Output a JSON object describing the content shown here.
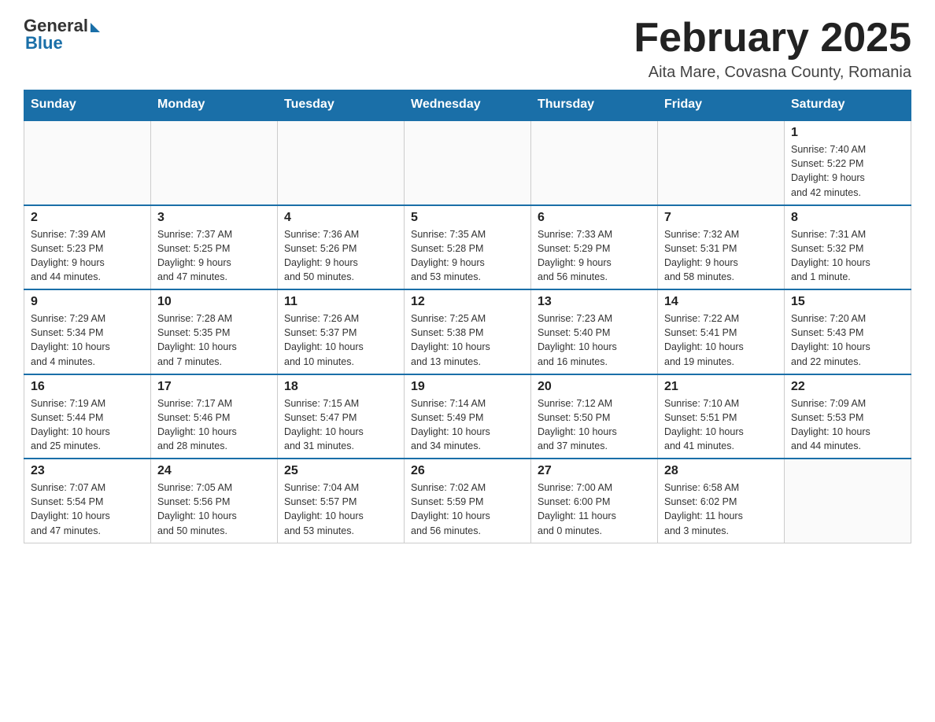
{
  "header": {
    "logo_general": "General",
    "logo_blue": "Blue",
    "month_title": "February 2025",
    "location": "Aita Mare, Covasna County, Romania"
  },
  "weekdays": [
    "Sunday",
    "Monday",
    "Tuesday",
    "Wednesday",
    "Thursday",
    "Friday",
    "Saturday"
  ],
  "weeks": [
    [
      {
        "day": "",
        "info": ""
      },
      {
        "day": "",
        "info": ""
      },
      {
        "day": "",
        "info": ""
      },
      {
        "day": "",
        "info": ""
      },
      {
        "day": "",
        "info": ""
      },
      {
        "day": "",
        "info": ""
      },
      {
        "day": "1",
        "info": "Sunrise: 7:40 AM\nSunset: 5:22 PM\nDaylight: 9 hours\nand 42 minutes."
      }
    ],
    [
      {
        "day": "2",
        "info": "Sunrise: 7:39 AM\nSunset: 5:23 PM\nDaylight: 9 hours\nand 44 minutes."
      },
      {
        "day": "3",
        "info": "Sunrise: 7:37 AM\nSunset: 5:25 PM\nDaylight: 9 hours\nand 47 minutes."
      },
      {
        "day": "4",
        "info": "Sunrise: 7:36 AM\nSunset: 5:26 PM\nDaylight: 9 hours\nand 50 minutes."
      },
      {
        "day": "5",
        "info": "Sunrise: 7:35 AM\nSunset: 5:28 PM\nDaylight: 9 hours\nand 53 minutes."
      },
      {
        "day": "6",
        "info": "Sunrise: 7:33 AM\nSunset: 5:29 PM\nDaylight: 9 hours\nand 56 minutes."
      },
      {
        "day": "7",
        "info": "Sunrise: 7:32 AM\nSunset: 5:31 PM\nDaylight: 9 hours\nand 58 minutes."
      },
      {
        "day": "8",
        "info": "Sunrise: 7:31 AM\nSunset: 5:32 PM\nDaylight: 10 hours\nand 1 minute."
      }
    ],
    [
      {
        "day": "9",
        "info": "Sunrise: 7:29 AM\nSunset: 5:34 PM\nDaylight: 10 hours\nand 4 minutes."
      },
      {
        "day": "10",
        "info": "Sunrise: 7:28 AM\nSunset: 5:35 PM\nDaylight: 10 hours\nand 7 minutes."
      },
      {
        "day": "11",
        "info": "Sunrise: 7:26 AM\nSunset: 5:37 PM\nDaylight: 10 hours\nand 10 minutes."
      },
      {
        "day": "12",
        "info": "Sunrise: 7:25 AM\nSunset: 5:38 PM\nDaylight: 10 hours\nand 13 minutes."
      },
      {
        "day": "13",
        "info": "Sunrise: 7:23 AM\nSunset: 5:40 PM\nDaylight: 10 hours\nand 16 minutes."
      },
      {
        "day": "14",
        "info": "Sunrise: 7:22 AM\nSunset: 5:41 PM\nDaylight: 10 hours\nand 19 minutes."
      },
      {
        "day": "15",
        "info": "Sunrise: 7:20 AM\nSunset: 5:43 PM\nDaylight: 10 hours\nand 22 minutes."
      }
    ],
    [
      {
        "day": "16",
        "info": "Sunrise: 7:19 AM\nSunset: 5:44 PM\nDaylight: 10 hours\nand 25 minutes."
      },
      {
        "day": "17",
        "info": "Sunrise: 7:17 AM\nSunset: 5:46 PM\nDaylight: 10 hours\nand 28 minutes."
      },
      {
        "day": "18",
        "info": "Sunrise: 7:15 AM\nSunset: 5:47 PM\nDaylight: 10 hours\nand 31 minutes."
      },
      {
        "day": "19",
        "info": "Sunrise: 7:14 AM\nSunset: 5:49 PM\nDaylight: 10 hours\nand 34 minutes."
      },
      {
        "day": "20",
        "info": "Sunrise: 7:12 AM\nSunset: 5:50 PM\nDaylight: 10 hours\nand 37 minutes."
      },
      {
        "day": "21",
        "info": "Sunrise: 7:10 AM\nSunset: 5:51 PM\nDaylight: 10 hours\nand 41 minutes."
      },
      {
        "day": "22",
        "info": "Sunrise: 7:09 AM\nSunset: 5:53 PM\nDaylight: 10 hours\nand 44 minutes."
      }
    ],
    [
      {
        "day": "23",
        "info": "Sunrise: 7:07 AM\nSunset: 5:54 PM\nDaylight: 10 hours\nand 47 minutes."
      },
      {
        "day": "24",
        "info": "Sunrise: 7:05 AM\nSunset: 5:56 PM\nDaylight: 10 hours\nand 50 minutes."
      },
      {
        "day": "25",
        "info": "Sunrise: 7:04 AM\nSunset: 5:57 PM\nDaylight: 10 hours\nand 53 minutes."
      },
      {
        "day": "26",
        "info": "Sunrise: 7:02 AM\nSunset: 5:59 PM\nDaylight: 10 hours\nand 56 minutes."
      },
      {
        "day": "27",
        "info": "Sunrise: 7:00 AM\nSunset: 6:00 PM\nDaylight: 11 hours\nand 0 minutes."
      },
      {
        "day": "28",
        "info": "Sunrise: 6:58 AM\nSunset: 6:02 PM\nDaylight: 11 hours\nand 3 minutes."
      },
      {
        "day": "",
        "info": ""
      }
    ]
  ]
}
